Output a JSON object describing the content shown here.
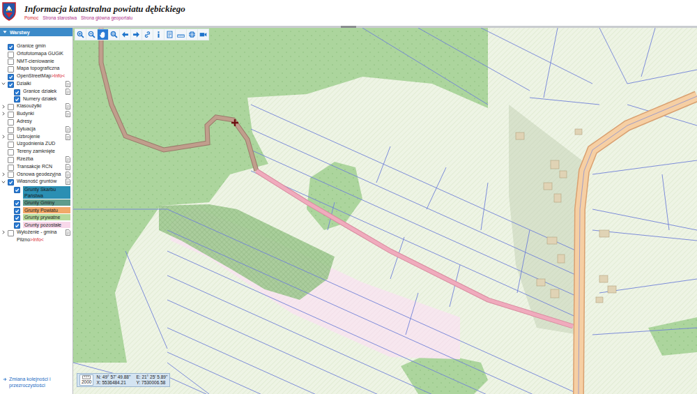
{
  "header": {
    "title": "Informacja katastralna powiatu dębickiego",
    "links": [
      {
        "label": "Pomoc",
        "color": "#d9232e"
      },
      {
        "label": "Strona starostwa",
        "color": "#b0308a"
      },
      {
        "label": "Strona główna geoportalu",
        "color": "#b0308a"
      }
    ]
  },
  "sidebar": {
    "title": "Warstwy",
    "expanded": true,
    "footer_link": "Zmiana kolejności i przezroczystości",
    "layers": [
      {
        "label": "Granice gmin",
        "checked": true
      },
      {
        "label": "Ortofotomapa GUGiK",
        "checked": false
      },
      {
        "label": "NMT-cieniowanie",
        "checked": false
      },
      {
        "label": "Mapa topograficzna",
        "checked": false
      },
      {
        "label": "OpenStreetMap",
        "checked": true,
        "info": ">Info<"
      },
      {
        "label": "Działki",
        "checked": true,
        "expanded": true,
        "legend": true,
        "children": [
          {
            "label": "Granice działek",
            "checked": true,
            "legend": true
          },
          {
            "label": "Numery działek",
            "checked": true
          }
        ]
      },
      {
        "label": "Klasoużytki",
        "checked": false,
        "expanded": false,
        "legend": true
      },
      {
        "label": "Budynki",
        "checked": false,
        "expanded": false,
        "legend": true
      },
      {
        "label": "Adresy",
        "checked": false
      },
      {
        "label": "Sytuacja",
        "checked": false,
        "legend": true
      },
      {
        "label": "Uzbrojenie",
        "checked": false,
        "expanded": false,
        "legend": true
      },
      {
        "label": "Uzgodnienia ZUD",
        "checked": false
      },
      {
        "label": "Tereny zamknięte",
        "checked": false
      },
      {
        "label": "Rzeźba",
        "checked": false,
        "legend": true
      },
      {
        "label": "Transakcje RCN",
        "checked": false,
        "legend": true
      },
      {
        "label": "Osnowa geodezyjna",
        "checked": false,
        "expanded": false,
        "legend": true
      },
      {
        "label": "Własność gruntów",
        "checked": true,
        "expanded": true,
        "legend": true,
        "children": [
          {
            "label": "Grunty Skarbu Państwa",
            "checked": true,
            "color": "#2b8fb3"
          },
          {
            "label": "Grunty Gminy",
            "checked": true,
            "color": "#5f9c8c"
          },
          {
            "label": "Grunty Powiatu",
            "checked": true,
            "color": "#f2a968"
          },
          {
            "label": "Grunty prywatne",
            "checked": true,
            "color": "#b7da9c"
          },
          {
            "label": "Grunty pozostałe",
            "checked": true,
            "color": "#f8d8ea"
          }
        ]
      },
      {
        "label": "Wyłożenie - gmina Pilzno",
        "checked": false,
        "expanded": false,
        "legend": true,
        "info": ">Info<"
      }
    ]
  },
  "toolbar": {
    "tools": [
      {
        "selected": false
      },
      {
        "selected": false
      },
      {
        "selected": true
      },
      {
        "selected": false
      },
      {
        "selected": false
      },
      {
        "selected": false
      },
      {
        "selected": false
      },
      {
        "selected": false
      },
      {
        "selected": false
      },
      {
        "selected": false
      },
      {
        "selected": false
      },
      {
        "selected": false
      }
    ]
  },
  "map": {
    "scale": "2000",
    "coords": {
      "n": "N: 49° 57' 49.88''",
      "e": "E: 21° 25' 5.89''",
      "x": "X: 5536484.21",
      "y": "Y: 7530006.58"
    }
  }
}
